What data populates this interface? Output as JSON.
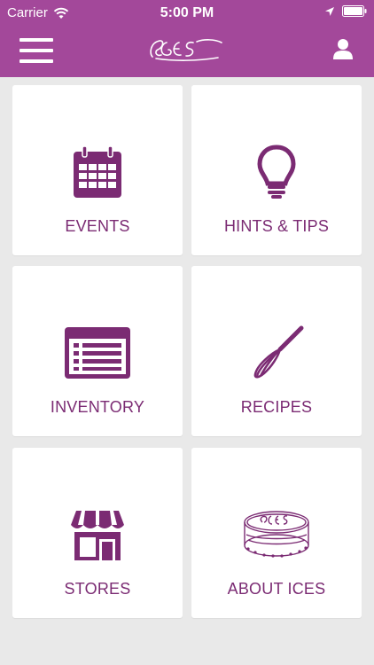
{
  "status_bar": {
    "carrier": "Carrier",
    "time": "5:00 PM"
  },
  "header": {
    "logo_text": "ICES"
  },
  "tiles": [
    {
      "label": "EVENTS",
      "icon": "calendar-icon"
    },
    {
      "label": "HINTS & TIPS",
      "icon": "lightbulb-icon"
    },
    {
      "label": "INVENTORY",
      "icon": "list-window-icon"
    },
    {
      "label": "RECIPES",
      "icon": "whisk-icon"
    },
    {
      "label": "STORES",
      "icon": "storefront-icon"
    },
    {
      "label": "ABOUT ICES",
      "icon": "cake-logo-icon"
    }
  ],
  "colors": {
    "header": "#a3489a",
    "accent": "#7b2b73",
    "background": "#e9e9e9"
  }
}
